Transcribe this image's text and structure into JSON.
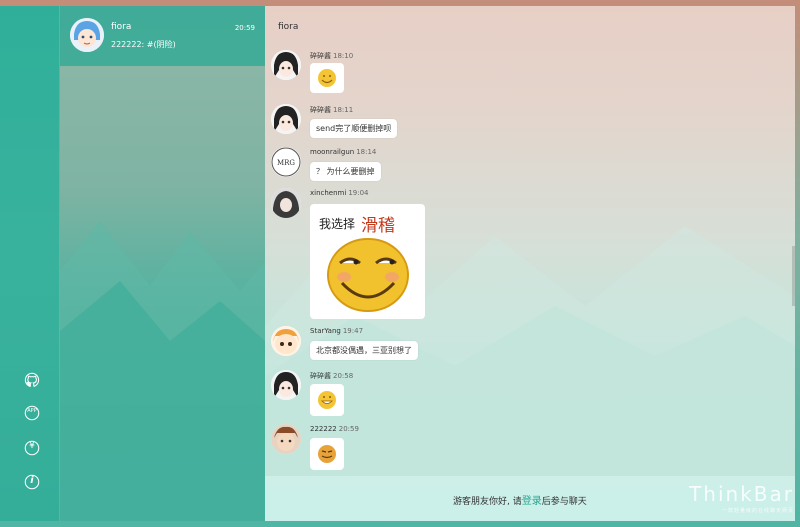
{
  "sidebar": {
    "icons": [
      {
        "name": "github-icon"
      },
      {
        "name": "app-icon",
        "label": "APP"
      },
      {
        "name": "yen-icon",
        "label": "¥"
      },
      {
        "name": "info-icon",
        "label": "i"
      }
    ]
  },
  "conversations": [
    {
      "name": "fiora",
      "time": "20:59",
      "preview": "222222: #(阴险)"
    }
  ],
  "chat": {
    "title": "fiora",
    "messages": [
      {
        "user": "碎碎酱",
        "time": "18:10",
        "type": "emoji"
      },
      {
        "user": "碎碎酱",
        "time": "18:11",
        "type": "text",
        "text": "send完了顺便删掉呗"
      },
      {
        "user": "moonrailgun",
        "time": "18:14",
        "type": "text",
        "text": "？ 为什么要删掉"
      },
      {
        "user": "xinchenmi",
        "time": "19:04",
        "type": "image",
        "caption_a": "我选择",
        "caption_b": "滑稽"
      },
      {
        "user": "StarYang",
        "time": "19:47",
        "type": "text",
        "text": "北京都没偶遇，三亚别想了"
      },
      {
        "user": "碎碎酱",
        "time": "20:58",
        "type": "emoji"
      },
      {
        "user": "222222",
        "time": "20:59",
        "type": "emoji"
      }
    ],
    "avatar_labels": {
      "moonrailgun": "MRG"
    }
  },
  "footer": {
    "prefix": "游客朋友你好, 请",
    "login": "登录",
    "suffix": "后参与聊天"
  },
  "brand": {
    "name": "ThinkBar",
    "tagline": "一款轻量级的在线聊天网页"
  },
  "colors": {
    "accent": "#2aa58f",
    "rail": "#34ad99"
  }
}
